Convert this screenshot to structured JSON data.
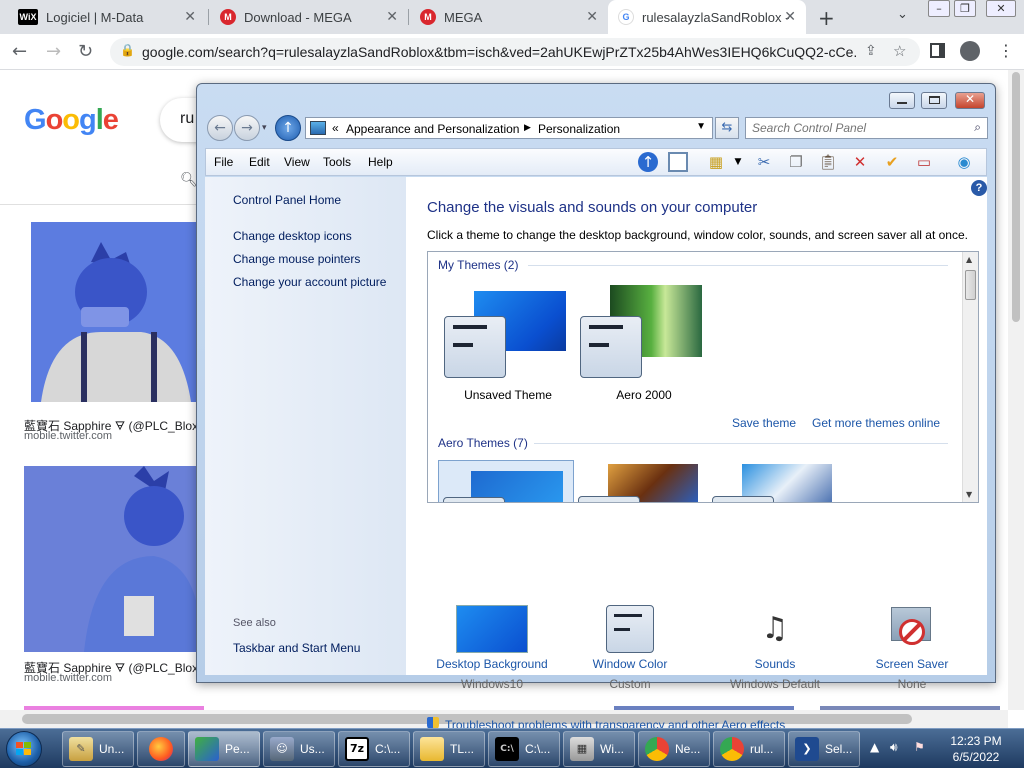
{
  "browser": {
    "tabs": [
      {
        "title": "Logiciel | M-Data",
        "favicon": "wix-icon"
      },
      {
        "title": "Download - MEGA",
        "favicon": "mega-icon"
      },
      {
        "title": "MEGA",
        "favicon": "mega-icon"
      },
      {
        "title": "rulesalayzlaSandRoblox -",
        "favicon": "google-icon",
        "active": true
      }
    ],
    "url": "google.com/search?q=rulesalayzlaSandRoblox&tbm=isch&ved=2ahUKEwjPrZTx25b4AhWes3IEHQ6kCuQQ2-cCe..."
  },
  "google": {
    "logo": "Google",
    "query_partial": "ru",
    "results": [
      {
        "caption": "藍寶石 Sapphire 🜃 (@PLC_Blox",
        "source": "mobile.twitter.com"
      },
      {
        "caption": "藍寶石 Sapphire 🜃 (@PLC_Blox",
        "source": "mobile.twitter.com"
      }
    ]
  },
  "control_panel": {
    "breadcrumb": [
      "Appearance and Personalization",
      "Personalization"
    ],
    "search_placeholder": "Search Control Panel",
    "menu": [
      "File",
      "Edit",
      "View",
      "Tools",
      "Help"
    ],
    "left_links": [
      "Control Panel Home",
      "Change desktop icons",
      "Change mouse pointers",
      "Change your account picture"
    ],
    "see_also": "See also",
    "see_also_links": [
      "Taskbar and Start Menu"
    ],
    "heading": "Change the visuals and sounds on your computer",
    "subheading": "Click a theme to change the desktop background, window color, sounds, and screen saver all at once.",
    "my_themes_label": "My Themes (2)",
    "my_themes": [
      "Unsaved Theme",
      "Aero 2000"
    ],
    "save_theme": "Save theme",
    "get_more": "Get more themes online",
    "aero_themes_label": "Aero Themes (7)",
    "bottom": [
      {
        "label": "Desktop Background",
        "value": "Windows10",
        "icon": "desktop-background-icon"
      },
      {
        "label": "Window Color",
        "value": "Custom",
        "icon": "window-color-icon"
      },
      {
        "label": "Sounds",
        "value": "Windows Default",
        "icon": "sounds-icon"
      },
      {
        "label": "Screen Saver",
        "value": "None",
        "icon": "screen-saver-icon"
      }
    ],
    "troubleshoot": "Troubleshoot problems with transparency and other Aero effects"
  },
  "taskbar": {
    "buttons": [
      {
        "label": "Un...",
        "icon": "paint-icon"
      },
      {
        "label": "",
        "icon": "firefox-icon"
      },
      {
        "label": "Pe...",
        "icon": "personalization-icon",
        "active": true
      },
      {
        "label": "Us...",
        "icon": "users-icon"
      },
      {
        "label": "C:\\...",
        "icon": "7zip-icon"
      },
      {
        "label": "TL...",
        "icon": "folder-icon"
      },
      {
        "label": "C:\\...",
        "icon": "cmd-icon"
      },
      {
        "label": "Wi...",
        "icon": "windows-icon"
      },
      {
        "label": "Ne...",
        "icon": "chrome-icon"
      },
      {
        "label": "rul...",
        "icon": "chrome-icon"
      },
      {
        "label": "Sel...",
        "icon": "powershell-icon"
      }
    ],
    "time": "12:23 PM",
    "date": "6/5/2022"
  }
}
